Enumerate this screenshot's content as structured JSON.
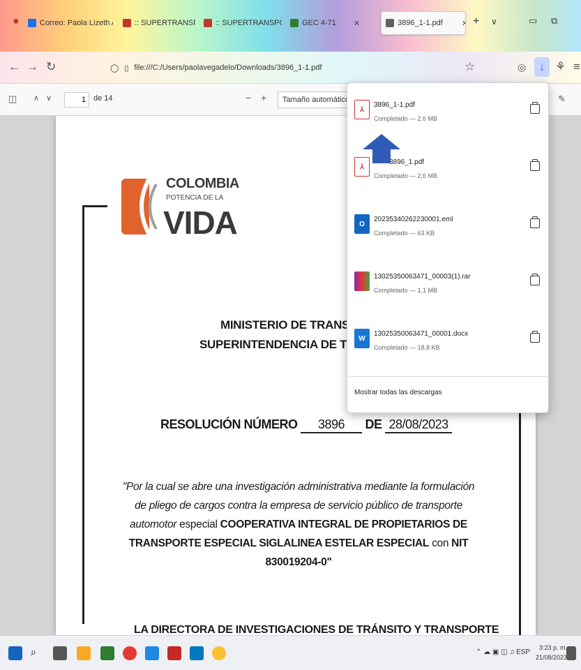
{
  "browser": {
    "tabs": [
      {
        "label": "Correo: Paola Lizeth A... ×",
        "color": "#1a73e8"
      },
      {
        "label": ":: SUPERTRANSPORTE ::",
        "color": "#c0392b"
      },
      {
        "label": ":: SUPERTRANSPORTE ::",
        "color": "#c0392b"
      },
      {
        "label": "GEC 4-71",
        "color": "#2e7d32"
      },
      {
        "label": "3896_1-1.pdf",
        "color": "#616161"
      }
    ],
    "new_tab_icon": "plus-icon",
    "tab_list_icon": "chevron-down-icon",
    "window_controls": [
      "minimize",
      "restore"
    ],
    "url": "file:///C:/Users/paolavegadelo/Downloads/3896_1-1.pdf"
  },
  "pdf_toolbar": {
    "page_number": "1",
    "page_count": "de 14",
    "zoom": "Tamaño automático"
  },
  "document": {
    "logo": {
      "line1": "COLOMBIA",
      "line2": "POTENCIA DE LA",
      "line3": "VIDA"
    },
    "ministry": "MINISTERIO DE TRANSPO",
    "superintendency": "SUPERINTENDENCIA DE TRAN",
    "resolution_label": "RESOLUCIÓN NÚMERO",
    "resolution_number": "3896",
    "resolution_de": "DE",
    "resolution_date": "28/08/2023",
    "para_italic": "\"Por la cual se abre una investigación administrativa mediante la formulación de pliego de cargos contra la empresa de servicio público de transporte automotor",
    "para_especial": "especial",
    "para_company": "COOPERATIVA INTEGRAL DE PROPIETARIOS DE TRANSPORTE ESPECIAL SIGLALINEA ESTELAR ESPECIAL",
    "para_con": "con",
    "para_nit": "NIT 830019204-0\"",
    "director": "LA DIRECTORA DE INVESTIGACIONES DE TRÁNSITO Y TRANSPORTE"
  },
  "downloads": {
    "items": [
      {
        "name": "3896_1-1.pdf",
        "status": "Completado — 2,6 MB",
        "type": "pdf",
        "color": "#d32f2f"
      },
      {
        "name": "3896_1.pdf",
        "status": "Completado — 2,6 MB",
        "type": "pdf",
        "color": "#d32f2f"
      },
      {
        "name": "20235340262230001.eml",
        "status": "Completado — 63 KB",
        "type": "outlook",
        "color": "#1565c0"
      },
      {
        "name": "13025350063471_00003(1).rar",
        "status": "Completado — 1,1 MB",
        "type": "rar",
        "color": "#8e24aa"
      },
      {
        "name": "13025350063471_00001.docx",
        "status": "Completado — 18,8 KB",
        "type": "word",
        "color": "#1976d2"
      }
    ],
    "show_all": "Mostrar todas las descargas"
  },
  "taskbar": {
    "app_colors": [
      "#1565c0",
      "#f9a825",
      "#2e7d32",
      "#e53935",
      "#1e88e5",
      "#c62828",
      "#0277bd",
      "#fbc02d"
    ],
    "tray_lang": "ESP",
    "time": "3:23 p. m.",
    "date": "21/08/2023"
  }
}
